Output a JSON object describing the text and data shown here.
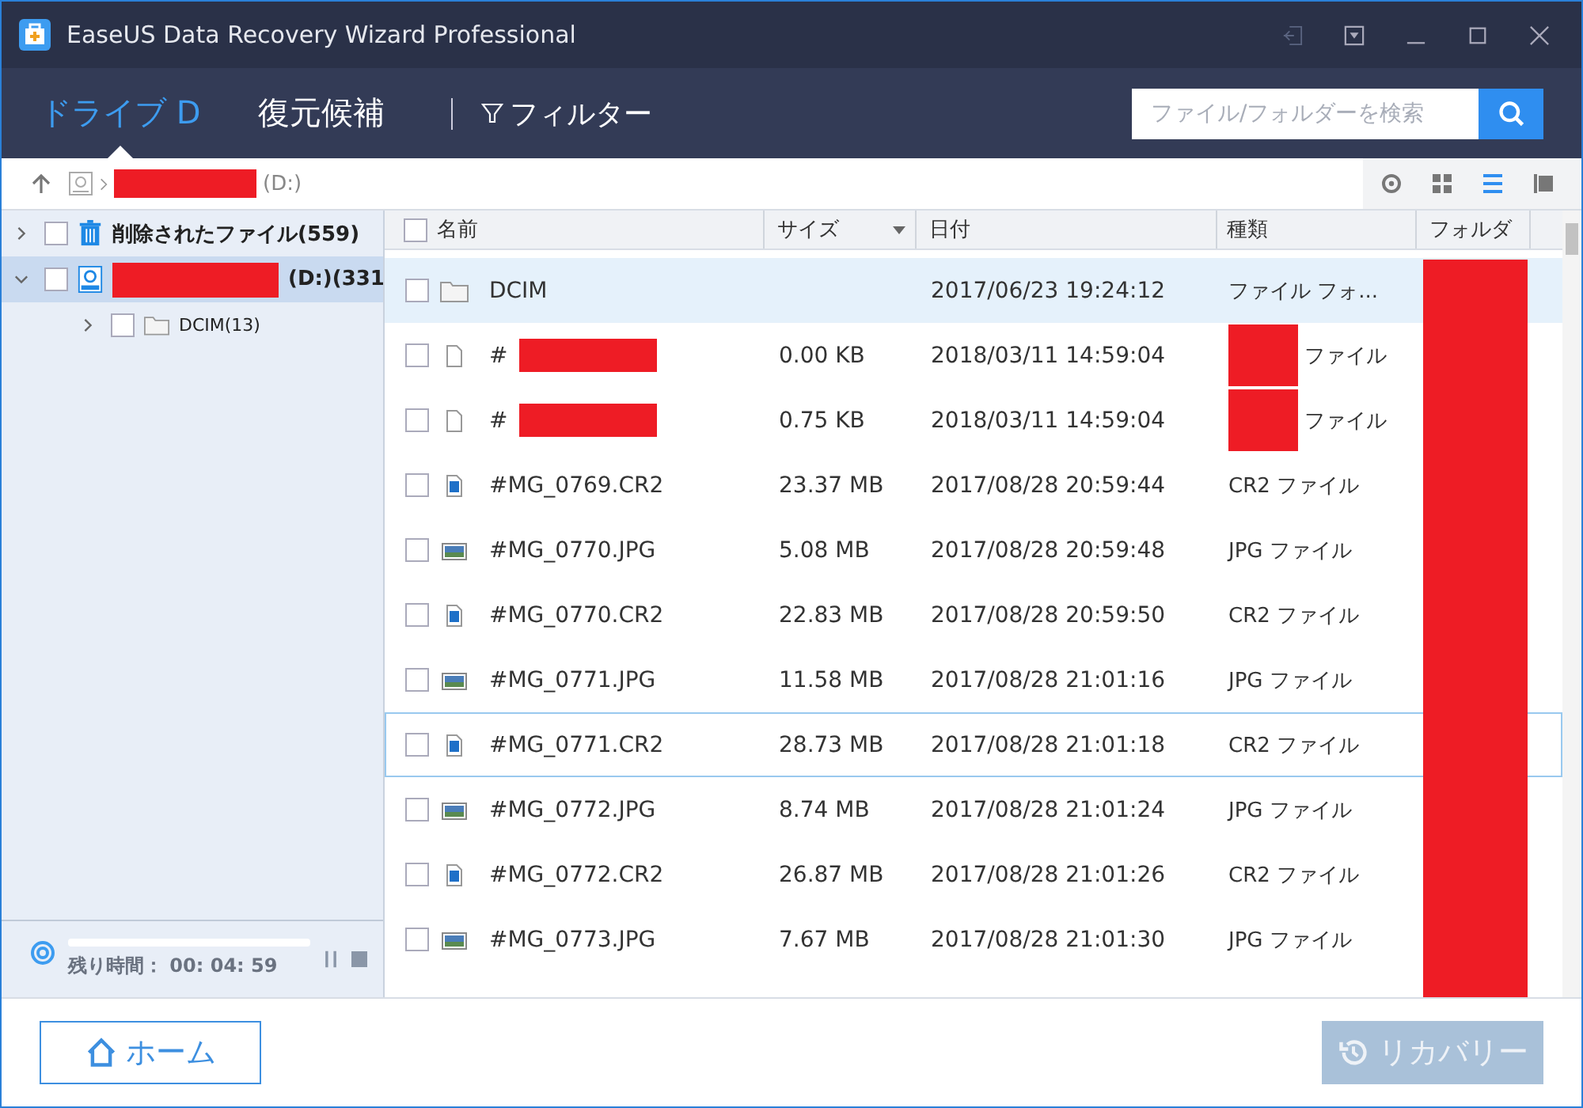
{
  "window": {
    "title": "EaseUS Data Recovery Wizard Professional"
  },
  "tabs": [
    {
      "label": "ドライブ D",
      "selected": true
    },
    {
      "label": "復元候補",
      "selected": false
    }
  ],
  "filter": {
    "label": "フィルター"
  },
  "search": {
    "placeholder": "ファイル/フォルダーを検索"
  },
  "breadcrumb": {
    "redacted": true,
    "drive": "(D:)"
  },
  "view_modes": [
    {
      "kind": "preview",
      "selected": false
    },
    {
      "kind": "grid",
      "selected": false
    },
    {
      "kind": "list",
      "selected": true
    },
    {
      "kind": "panel",
      "selected": false
    }
  ],
  "sidebar": {
    "items": [
      {
        "kind": "trash",
        "label": "削除されたファイル(559)",
        "redacted": false,
        "expanded": false,
        "checked": false,
        "selected": false
      },
      {
        "kind": "drive",
        "label": "(D:)(331",
        "redacted": true,
        "expanded": true,
        "checked": false,
        "selected": true,
        "children": [
          {
            "kind": "folder",
            "label": "DCIM(13)",
            "redacted": false,
            "expanded": false,
            "checked": false,
            "selected": false
          }
        ]
      }
    ]
  },
  "scan": {
    "remaining": "残り時間： 00: 04: 59"
  },
  "table": {
    "columns": [
      "名前",
      "サイズ",
      "日付",
      "種類",
      "フォルダ"
    ],
    "folder_redacted": true,
    "select_all_checked": false,
    "rows": [
      {
        "kind": "folder",
        "name": "DCIM",
        "name_redacted": false,
        "date": "2017/06/23 19:24:12",
        "type": "ファイル フォ...",
        "type_redacted": false,
        "checked": false,
        "selected": true,
        "focused": false
      },
      {
        "kind": "file",
        "name": "#",
        "name_redacted": true,
        "size": "0.00 KB",
        "date": "2018/03/11 14:59:04",
        "type": "ファイル",
        "type_redacted": true,
        "checked": false,
        "selected": false,
        "focused": false
      },
      {
        "kind": "file",
        "name": "#",
        "name_redacted": true,
        "size": "0.75 KB",
        "date": "2018/03/11 14:59:04",
        "type": "ファイル",
        "type_redacted": true,
        "checked": false,
        "selected": false,
        "focused": false
      },
      {
        "kind": "raw",
        "name": "#MG_0769.CR2",
        "name_redacted": false,
        "size": "23.37 MB",
        "date": "2017/08/28 20:59:44",
        "type": "CR2 ファイル",
        "type_redacted": false,
        "checked": false,
        "selected": false,
        "focused": false
      },
      {
        "kind": "image",
        "name": "#MG_0770.JPG",
        "name_redacted": false,
        "size": "5.08 MB",
        "date": "2017/08/28 20:59:48",
        "type": "JPG ファイル",
        "type_redacted": false,
        "checked": false,
        "selected": false,
        "focused": false
      },
      {
        "kind": "raw",
        "name": "#MG_0770.CR2",
        "name_redacted": false,
        "size": "22.83 MB",
        "date": "2017/08/28 20:59:50",
        "type": "CR2 ファイル",
        "type_redacted": false,
        "checked": false,
        "selected": false,
        "focused": false
      },
      {
        "kind": "image",
        "name": "#MG_0771.JPG",
        "name_redacted": false,
        "size": "11.58 MB",
        "date": "2017/08/28 21:01:16",
        "type": "JPG ファイル",
        "type_redacted": false,
        "checked": false,
        "selected": false,
        "focused": false
      },
      {
        "kind": "raw",
        "name": "#MG_0771.CR2",
        "name_redacted": false,
        "size": "28.73 MB",
        "date": "2017/08/28 21:01:18",
        "type": "CR2 ファイル",
        "type_redacted": false,
        "checked": false,
        "selected": false,
        "focused": true
      },
      {
        "kind": "image",
        "name": "#MG_0772.JPG",
        "name_redacted": false,
        "size": "8.74 MB",
        "date": "2017/08/28 21:01:24",
        "type": "JPG ファイル",
        "type_redacted": false,
        "checked": false,
        "selected": false,
        "focused": false
      },
      {
        "kind": "raw",
        "name": "#MG_0772.CR2",
        "name_redacted": false,
        "size": "26.87 MB",
        "date": "2017/08/28 21:01:26",
        "type": "CR2 ファイル",
        "type_redacted": false,
        "checked": false,
        "selected": false,
        "focused": false
      },
      {
        "kind": "image",
        "name": "#MG_0773.JPG",
        "name_redacted": false,
        "size": "7.67 MB",
        "date": "2017/08/28 21:01:30",
        "type": "JPG ファイル",
        "type_redacted": false,
        "checked": false,
        "selected": false,
        "focused": false
      }
    ]
  },
  "buttons": [
    {
      "kind": "home",
      "label": "ホーム",
      "disabled": false
    },
    {
      "kind": "recover",
      "label": "リカバリー",
      "disabled": true
    }
  ]
}
